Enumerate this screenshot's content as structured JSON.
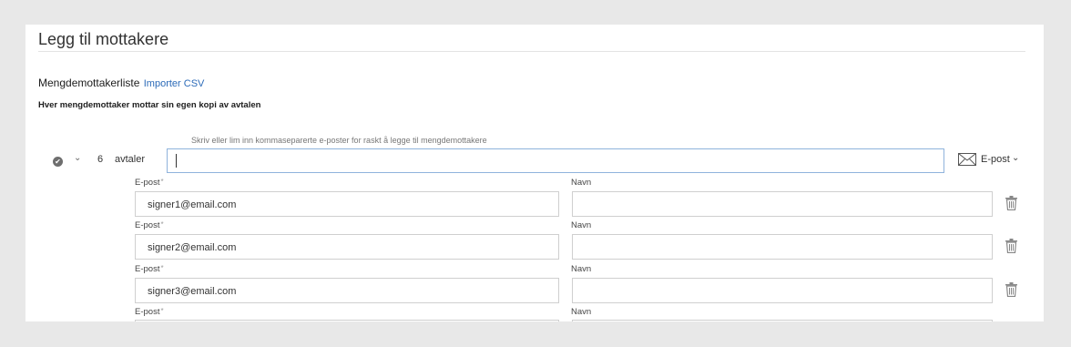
{
  "header": {
    "title": "Legg til mottakere"
  },
  "bulk": {
    "list_label": "Mengdemottakerliste",
    "import_link": "Importer CSV",
    "description": "Hver mengdemottaker mottar sin egen kopi av avtalen",
    "hint": "Skriv eller lim inn kommaseparerte e-poster for raskt å legge til mengdemottakere",
    "count": "6",
    "count_label": "avtaler",
    "input_value": "",
    "delivery": {
      "label": "E-post",
      "icon": "envelope-icon"
    }
  },
  "fields": {
    "email_label": "E-post",
    "required_mark": "*",
    "name_label": "Navn"
  },
  "recipients": [
    {
      "email": "signer1@email.com",
      "name": ""
    },
    {
      "email": "signer2@email.com",
      "name": ""
    },
    {
      "email": "signer3@email.com",
      "name": ""
    },
    {
      "email": "",
      "name": ""
    }
  ],
  "colors": {
    "link": "#2c6bb8",
    "input_focus_border": "#8fb3dc",
    "background": "#e8e8e8"
  }
}
